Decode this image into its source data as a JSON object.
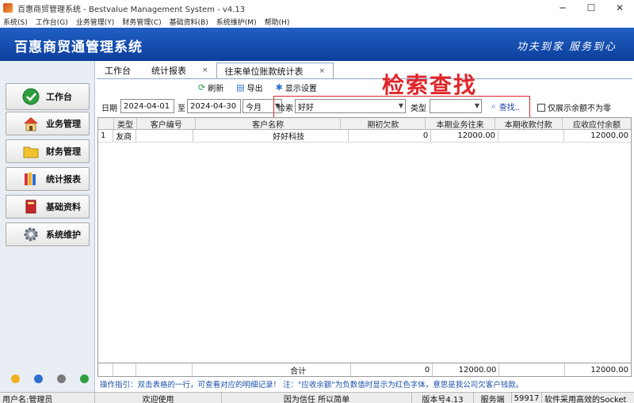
{
  "window": {
    "title": "百惠商贸管理系统 - Bestvalue Management System - v4.13",
    "controls": [
      "─",
      "☐",
      "✕"
    ]
  },
  "menu": [
    "系统(S)",
    "工作台(G)",
    "业务管理(Y)",
    "财务管理(C)",
    "基础资料(B)",
    "系统维护(M)",
    "帮助(H)"
  ],
  "banner": {
    "title": "百惠商贸通管理系统",
    "slogan": "功夫到家 服务到心"
  },
  "sidebar": {
    "items": [
      {
        "label": "工作台",
        "icon": "check-circle-icon"
      },
      {
        "label": "业务管理",
        "icon": "house-icon"
      },
      {
        "label": "财务管理",
        "icon": "folder-icon"
      },
      {
        "label": "统计报表",
        "icon": "books-icon"
      },
      {
        "label": "基础资料",
        "icon": "book-icon"
      },
      {
        "label": "系统维护",
        "icon": "gear-icon"
      }
    ],
    "bottom_icons": [
      "edit-icon",
      "info-icon",
      "help-icon",
      "exit-icon"
    ]
  },
  "tabs": [
    {
      "label": "工作台"
    },
    {
      "label": "统计报表",
      "close": "×"
    },
    {
      "label": "往来单位账款统计表",
      "close": "×"
    }
  ],
  "toolbar": {
    "refresh": "刷新",
    "export": "导出",
    "display": "显示设置"
  },
  "annotation": "检索查找",
  "filter": {
    "date_label": "日期",
    "date_from": "2024-04-01",
    "to_label": "至",
    "date_to": "2024-04-30",
    "period": "今月",
    "search_label": "检索",
    "search_value": "好好",
    "type_label": "类型",
    "type_value": "",
    "find_button": "查找..",
    "nonzero_checkbox": "仅展示余额不为零"
  },
  "table": {
    "headers": [
      "",
      "类型",
      "客户编号",
      "客户名称",
      "期初欠款",
      "本期业务往来",
      "本期收款付款",
      "应收应付余额"
    ],
    "rows": [
      [
        "1",
        "友商",
        "",
        "好好科技",
        "0",
        "12000.00",
        "",
        "12000.00"
      ]
    ],
    "footer": [
      "",
      "",
      "",
      "合计",
      "0",
      "12000.00",
      "",
      "12000.00"
    ]
  },
  "hint": "操作指引：双击表格的一行，可查看对应的明细记录！ 注：\"应收余额\"为负数值时显示为红色字体，意思是我公司欠客户钱款。",
  "status": {
    "user": "用户名:管理员",
    "welcome": "欢迎使用",
    "motto": "因为信任 所以简单",
    "version": "版本号4.13",
    "server_label": "服务端",
    "port": "59917",
    "note": "软件采用高效的Socket"
  }
}
